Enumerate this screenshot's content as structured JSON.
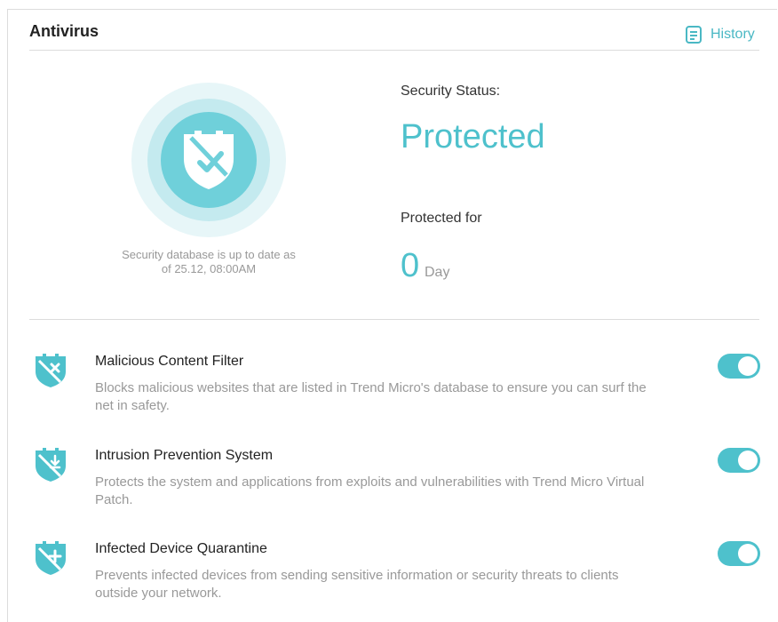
{
  "header": {
    "title": "Antivirus",
    "history_label": "History"
  },
  "status": {
    "db_text": "Security database is up to date as of 25.12, 08:00AM",
    "security_label": "Security Status:",
    "security_value": "Protected",
    "protected_for_label": "Protected for",
    "protected_for_value": "0",
    "protected_for_unit": "Day"
  },
  "features": [
    {
      "title": "Malicious Content Filter",
      "description": "Blocks malicious websites that are listed in Trend Micro's database to ensure you can surf the net in safety.",
      "enabled": true,
      "icon": "shield-x-icon"
    },
    {
      "title": "Intrusion Prevention System",
      "description": "Protects the system and applications from exploits and vulnerabilities with Trend Micro Virtual Patch.",
      "enabled": true,
      "icon": "shield-download-icon"
    },
    {
      "title": "Infected Device Quarantine",
      "description": "Prevents infected devices from sending sensitive information or security threats to clients outside your network.",
      "enabled": true,
      "icon": "shield-plus-icon"
    }
  ],
  "colors": {
    "accent": "#4ec1cc",
    "muted_text": "#999999"
  }
}
